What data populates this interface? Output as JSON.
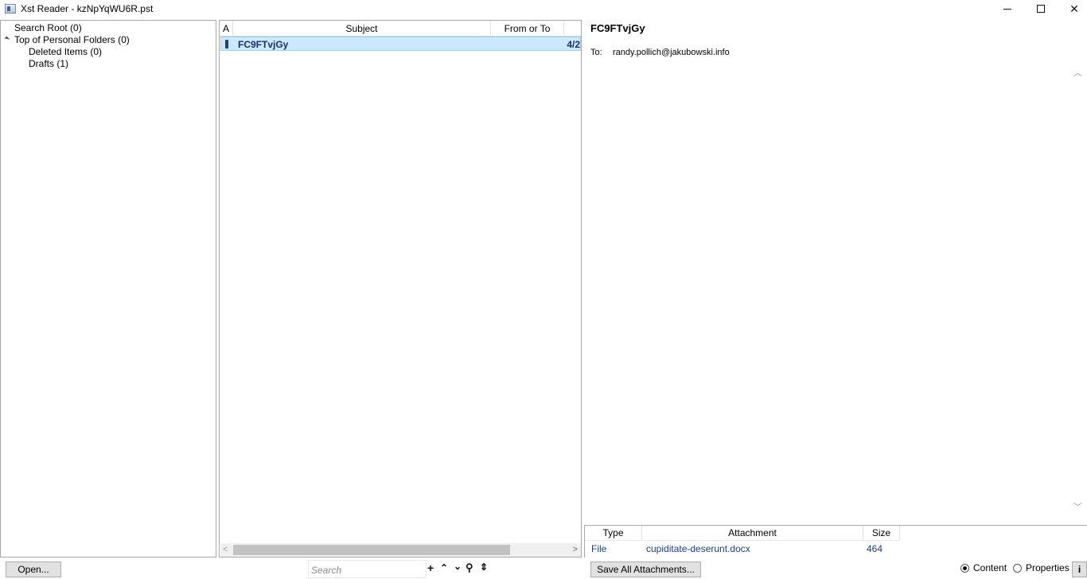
{
  "window": {
    "title": "Xst Reader - kzNpYqWU6R.pst",
    "icon": "app-icon"
  },
  "tree": {
    "items": [
      {
        "label": "Search Root (0)"
      },
      {
        "label": "Top of Personal Folders (0)"
      },
      {
        "label": "Deleted Items (0)"
      },
      {
        "label": "Drafts (1)"
      }
    ]
  },
  "message_list": {
    "columns": [
      "A",
      "Subject",
      "From or To",
      ""
    ],
    "rows": [
      {
        "subject": "FC9FTvjGy",
        "from_or_to": "",
        "date": "4/2"
      }
    ]
  },
  "reader": {
    "subject": "FC9FTvjGy",
    "to_label": "To:",
    "to_value": "randy.pollich@jakubowski.info",
    "attachments": {
      "columns": [
        "Type",
        "Attachment",
        "Size"
      ],
      "rows": [
        {
          "type": "File",
          "name": "cupiditate-deserunt.docx",
          "size": "464"
        }
      ]
    }
  },
  "bottombar": {
    "open_label": "Open...",
    "search_placeholder": "Search",
    "save_all_label": "Save All Attachments...",
    "radio_content": "Content",
    "radio_properties": "Properties",
    "selected_view": "Content",
    "info_label": "i"
  }
}
